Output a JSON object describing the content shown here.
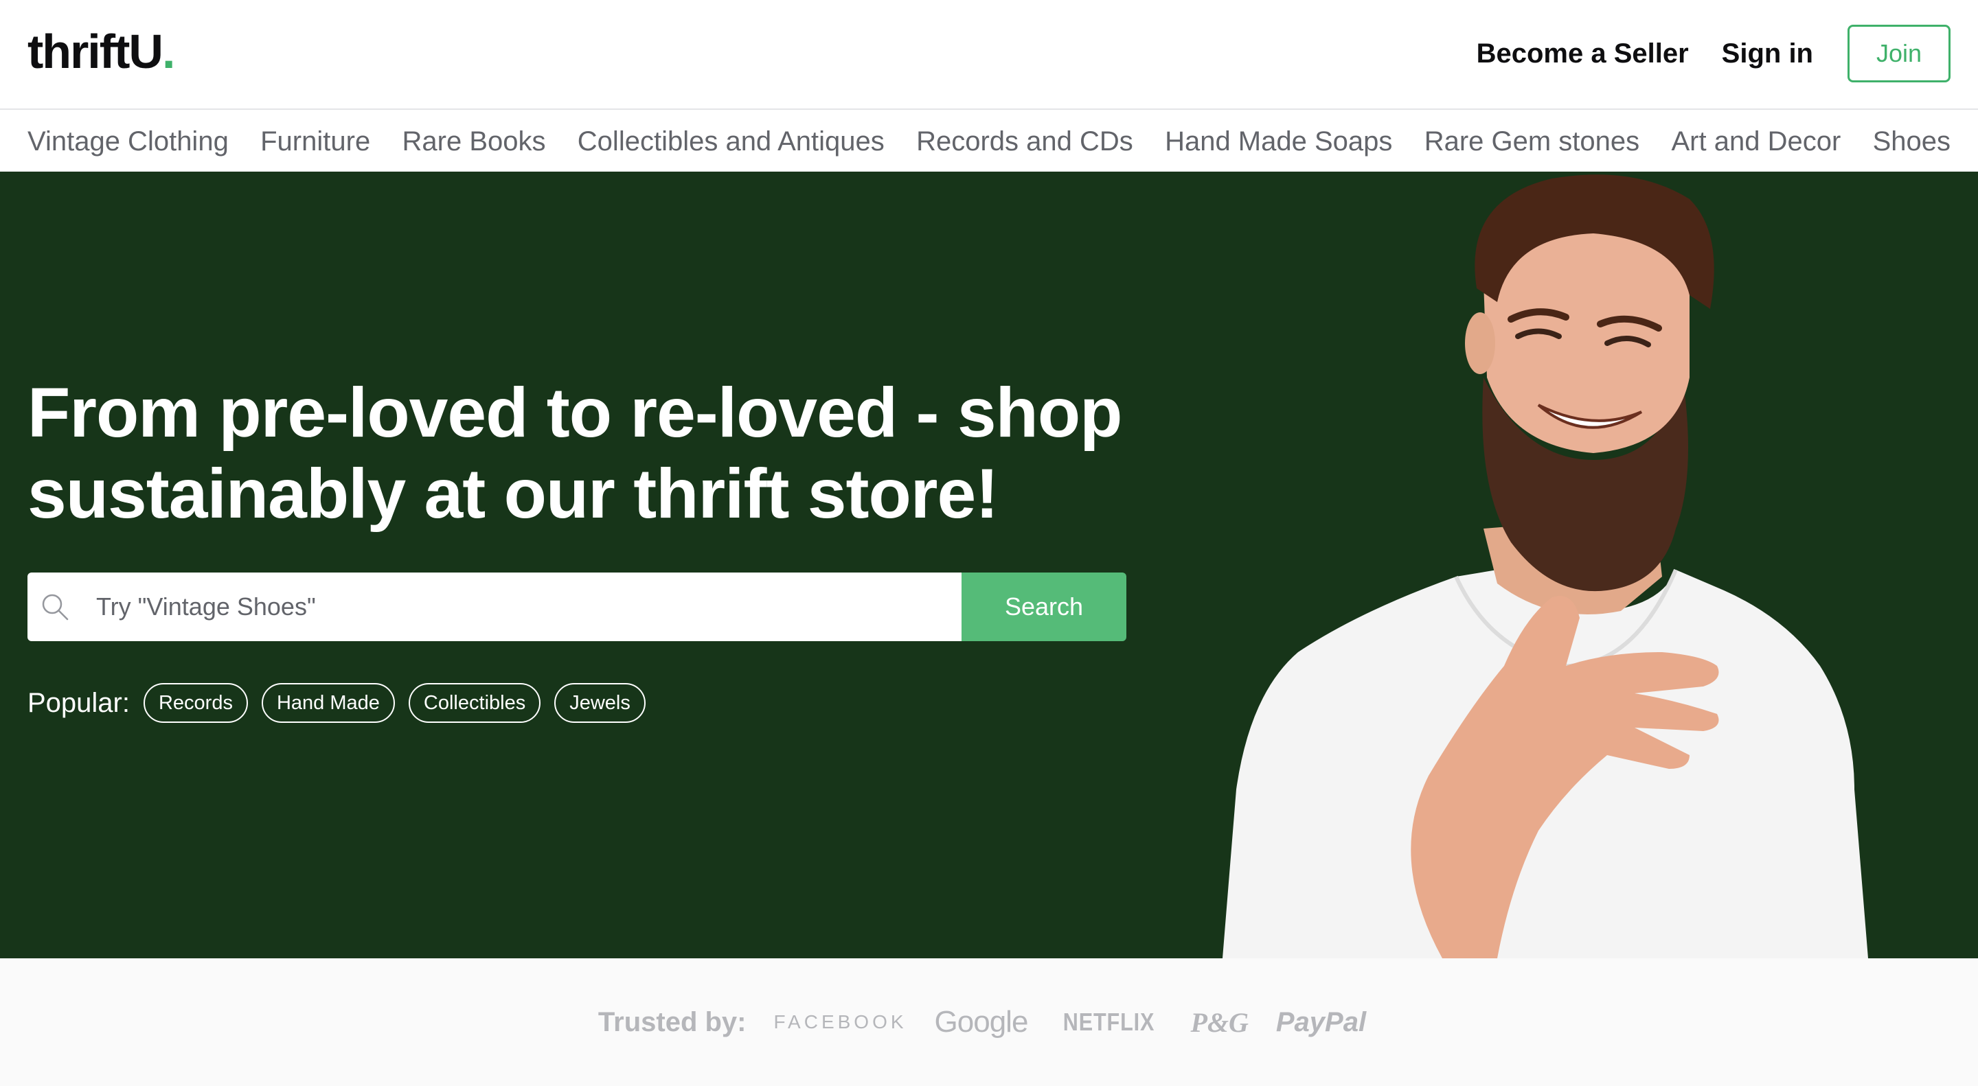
{
  "header": {
    "logo_text": "thriftU",
    "logo_dot": ".",
    "become_seller": "Become a Seller",
    "sign_in": "Sign in",
    "join": "Join"
  },
  "categories": [
    "Vintage Clothing",
    "Furniture",
    "Rare Books",
    "Collectibles and Antiques",
    "Records and CDs",
    "Hand Made Soaps",
    "Rare Gem stones",
    "Art and Decor",
    "Shoes"
  ],
  "hero": {
    "title_line1": "From pre-loved to re-loved - shop",
    "title_line2": "sustainably at our thrift store!",
    "search": {
      "placeholder": "Try \"Vintage Shoes\"",
      "value": "",
      "button": "Search"
    },
    "popular": {
      "label": "Popular:",
      "tags": [
        "Records",
        "Hand Made",
        "Collectibles",
        "Jewels"
      ]
    }
  },
  "trusted": {
    "label": "Trusted by:",
    "brands": [
      "FACEBOOK",
      "Google",
      "NETFLIX",
      "P&G",
      "PayPal"
    ]
  },
  "colors": {
    "brand_green": "#3fb16a",
    "hero_bg": "#173519",
    "search_button": "#55bb78",
    "muted_text": "#62646a",
    "trusted_gray": "#b5b6ba"
  },
  "icons": {
    "search": "search-icon"
  }
}
